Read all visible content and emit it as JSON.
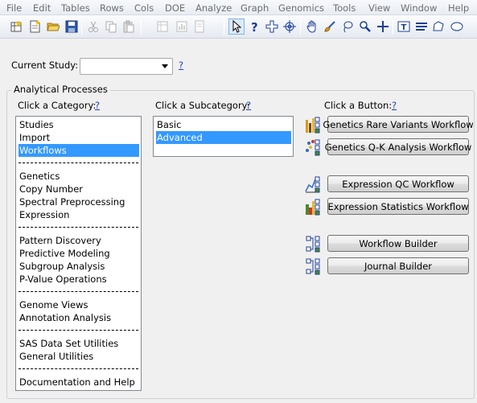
{
  "menubar": {
    "items": [
      "File",
      "Edit",
      "Tables",
      "Rows",
      "Cols",
      "DOE",
      "Analyze",
      "Graph",
      "Genomics",
      "Tools",
      "View",
      "Window",
      "Help"
    ]
  },
  "study": {
    "label": "Current Study:",
    "selected_value": "",
    "help": "?"
  },
  "analytical_processes": {
    "title": "Analytical Processes",
    "category_header": "Click a Category:",
    "subcategory_header": "Click a Subcategory:",
    "button_header": "Click a Button:",
    "help": "?",
    "categories": [
      "Studies",
      "Import",
      "Workflows",
      "Genetics",
      "Copy Number",
      "Spectral Preprocessing",
      "Expression",
      "Pattern Discovery",
      "Predictive Modeling",
      "Subgroup Analysis",
      "P-Value Operations",
      "Genome Views",
      "Annotation Analysis",
      "SAS Data Set Utilities",
      "General Utilities",
      "Documentation and Help"
    ],
    "selected_category": "Workflows",
    "subcategories": [
      "Basic",
      "Advanced"
    ],
    "selected_subcategory": "Advanced",
    "buttons": [
      "Genetics Rare Variants Workflow",
      "Genetics Q-K Analysis Workflow",
      "Expression QC Workflow",
      "Expression Statistics Workflow",
      "Workflow Builder",
      "Journal Builder"
    ]
  }
}
